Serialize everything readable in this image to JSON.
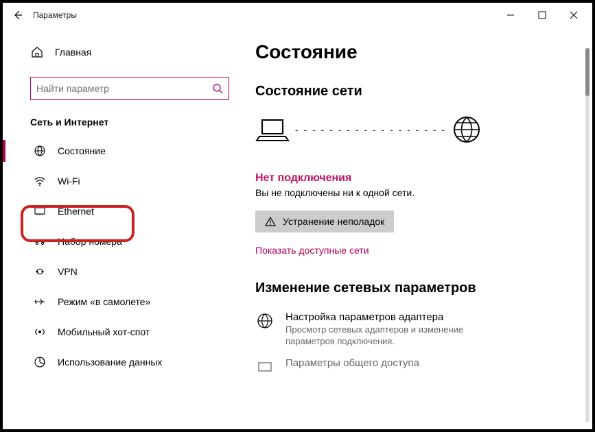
{
  "titlebar": {
    "title": "Параметры"
  },
  "sidebar": {
    "home": "Главная",
    "search_placeholder": "Найти параметр",
    "section": "Сеть и Интернет",
    "items": [
      {
        "label": "Состояние"
      },
      {
        "label": "Wi-Fi"
      },
      {
        "label": "Ethernet"
      },
      {
        "label": "Набор номера"
      },
      {
        "label": "VPN"
      },
      {
        "label": "Режим «в самолете»"
      },
      {
        "label": "Мобильный хот-спот"
      },
      {
        "label": "Использование данных"
      }
    ]
  },
  "main": {
    "title": "Состояние",
    "section1_title": "Состояние сети",
    "no_conn_title": "Нет подключения",
    "no_conn_sub": "Вы не подключены ни к одной сети.",
    "troubleshoot": "Устранение неполадок",
    "show_available": "Показать доступные сети",
    "section2_title": "Изменение сетевых параметров",
    "adapter_title": "Настройка параметров адаптера",
    "adapter_desc": "Просмотр сетевых адаптеров и изменение параметров подключения.",
    "sharing_title": "Параметры общего доступа"
  }
}
